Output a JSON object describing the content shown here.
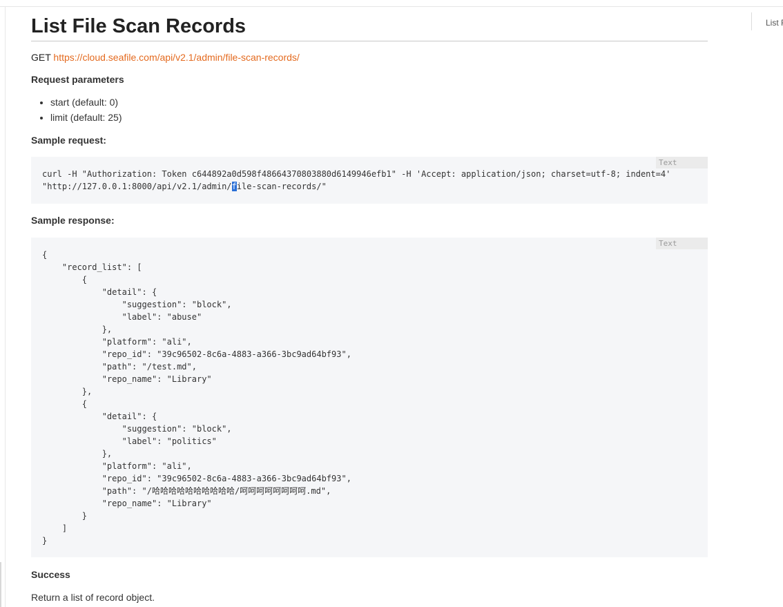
{
  "page": {
    "title": "List File Scan Records",
    "method": "GET",
    "url": "https://cloud.seafile.com/api/v2.1/admin/file-scan-records/"
  },
  "toc": {
    "label": "List F"
  },
  "request_parameters": {
    "label": "Request parameters",
    "items": [
      "start (default: 0)",
      "limit (default: 25)"
    ]
  },
  "sample_request": {
    "label": "Sample request:",
    "lang": "Text",
    "line1": "curl -H \"Authorization: Token c644892a0d598f48664370803880d6149946efb1\" -H 'Accept: application/json; charset=utf-8; indent=4'",
    "line2_before": "\"http://127.0.0.1:8000/api/v2.1/admin/",
    "line2_selected": "f",
    "line2_after": "ile-scan-records/\""
  },
  "sample_response": {
    "label": "Sample response:",
    "lang": "Text",
    "code": "{\n    \"record_list\": [\n        {\n            \"detail\": {\n                \"suggestion\": \"block\",\n                \"label\": \"abuse\"\n            },\n            \"platform\": \"ali\",\n            \"repo_id\": \"39c96502-8c6a-4883-a366-3bc9ad64bf93\",\n            \"path\": \"/test.md\",\n            \"repo_name\": \"Library\"\n        },\n        {\n            \"detail\": {\n                \"suggestion\": \"block\",\n                \"label\": \"politics\"\n            },\n            \"platform\": \"ali\",\n            \"repo_id\": \"39c96502-8c6a-4883-a366-3bc9ad64bf93\",\n            \"path\": \"/哈哈哈哈哈哈哈哈哈哈/呵呵呵呵呵呵呵呵.md\",\n            \"repo_name\": \"Library\"\n        }\n    ]\n}"
  },
  "success": {
    "label": "Success",
    "text": "Return a list of record object."
  },
  "colors": {
    "link": "#e46a1f",
    "code_bg": "#f5f6f8",
    "selection": "#2a6fd6"
  }
}
